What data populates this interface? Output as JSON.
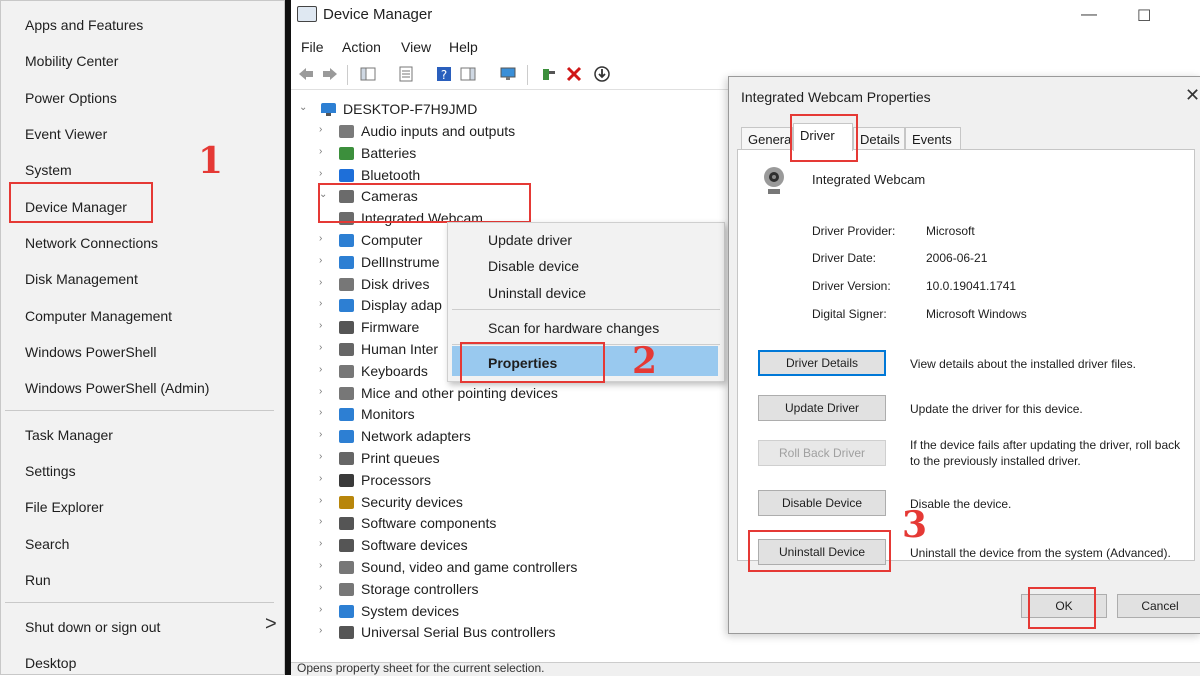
{
  "winx_menu": {
    "items": [
      "Apps and Features",
      "Mobility Center",
      "Power Options",
      "Event Viewer",
      "System",
      "Device Manager",
      "Network Connections",
      "Disk Management",
      "Computer Management",
      "Windows PowerShell",
      "Windows PowerShell (Admin)"
    ],
    "items2": [
      "Task Manager",
      "Settings",
      "File Explorer",
      "Search",
      "Run"
    ],
    "items3": [
      "Shut down or sign out",
      "Desktop"
    ],
    "submenu_arrow": ">"
  },
  "device_manager": {
    "title": "Device Manager",
    "window_controls": [
      "—",
      "☐"
    ],
    "menu": [
      "File",
      "Action",
      "View",
      "Help"
    ],
    "root": "DESKTOP-F7H9JMD",
    "categories": [
      {
        "label": "Audio inputs and outputs",
        "icon": "speaker-icon",
        "color": "#7a7a7a"
      },
      {
        "label": "Batteries",
        "icon": "battery-icon",
        "color": "#3c8f3c"
      },
      {
        "label": "Bluetooth",
        "icon": "bluetooth-icon",
        "color": "#1e6fd9"
      },
      {
        "label": "Cameras",
        "icon": "camera-icon",
        "color": "#6b6b6b"
      },
      {
        "label": "Integrated Webcam",
        "icon": "webcam-icon",
        "color": "#6b6b6b"
      },
      {
        "label": "Computer",
        "icon": "computer-icon",
        "color": "#2d7fd3"
      },
      {
        "label": "DellInstrume",
        "icon": "monitor-icon",
        "color": "#2d7fd3"
      },
      {
        "label": "Disk drives",
        "icon": "disk-icon",
        "color": "#777777"
      },
      {
        "label": "Display adap",
        "icon": "display-icon",
        "color": "#2d7fd3"
      },
      {
        "label": "Firmware",
        "icon": "firmware-icon",
        "color": "#555555"
      },
      {
        "label": "Human Inter",
        "icon": "hid-icon",
        "color": "#666666"
      },
      {
        "label": "Keyboards",
        "icon": "keyboard-icon",
        "color": "#777777"
      },
      {
        "label": "Mice and other pointing devices",
        "icon": "mouse-icon",
        "color": "#777777"
      },
      {
        "label": "Monitors",
        "icon": "monitor-icon",
        "color": "#2d7fd3"
      },
      {
        "label": "Network adapters",
        "icon": "network-icon",
        "color": "#2d7fd3"
      },
      {
        "label": "Print queues",
        "icon": "printer-icon",
        "color": "#666666"
      },
      {
        "label": "Processors",
        "icon": "processor-icon",
        "color": "#3a3a3a"
      },
      {
        "label": "Security devices",
        "icon": "security-icon",
        "color": "#b8860b"
      },
      {
        "label": "Software components",
        "icon": "software-component-icon",
        "color": "#555555"
      },
      {
        "label": "Software devices",
        "icon": "software-device-icon",
        "color": "#555555"
      },
      {
        "label": "Sound, video and game controllers",
        "icon": "sound-icon",
        "color": "#777777"
      },
      {
        "label": "Storage controllers",
        "icon": "storage-icon",
        "color": "#777777"
      },
      {
        "label": "System devices",
        "icon": "system-icon",
        "color": "#2d7fd3"
      },
      {
        "label": "Universal Serial Bus controllers",
        "icon": "usb-icon",
        "color": "#555555"
      }
    ],
    "status": "Opens property sheet for the current selection."
  },
  "context_menu": {
    "items": [
      "Update driver",
      "Disable device",
      "Uninstall device",
      "Scan for hardware changes",
      "Properties"
    ]
  },
  "dialog": {
    "title": "Integrated Webcam Properties",
    "close": "✕",
    "tabs": [
      "General",
      "Driver",
      "Details",
      "Events"
    ],
    "device_name": "Integrated Webcam",
    "fields": [
      {
        "label": "Driver Provider:",
        "value": "Microsoft"
      },
      {
        "label": "Driver Date:",
        "value": "2006-06-21"
      },
      {
        "label": "Driver Version:",
        "value": "10.0.19041.1741"
      },
      {
        "label": "Digital Signer:",
        "value": "Microsoft Windows"
      }
    ],
    "buttons": [
      {
        "label": "Driver Details",
        "desc": "View details about the installed driver files."
      },
      {
        "label": "Update Driver",
        "desc": "Update the driver for this device."
      },
      {
        "label": "Roll Back Driver",
        "desc": "If the device fails after updating the driver, roll back to the previously installed driver."
      },
      {
        "label": "Disable Device",
        "desc": "Disable the device."
      },
      {
        "label": "Uninstall Device",
        "desc": "Uninstall the device from the system (Advanced)."
      }
    ],
    "ok": "OK",
    "cancel": "Cancel"
  },
  "steps": [
    "1",
    "2",
    "3"
  ],
  "colors": {
    "highlight": "#e53935",
    "selection": "#99c9ef",
    "focus": "#0078d7"
  }
}
